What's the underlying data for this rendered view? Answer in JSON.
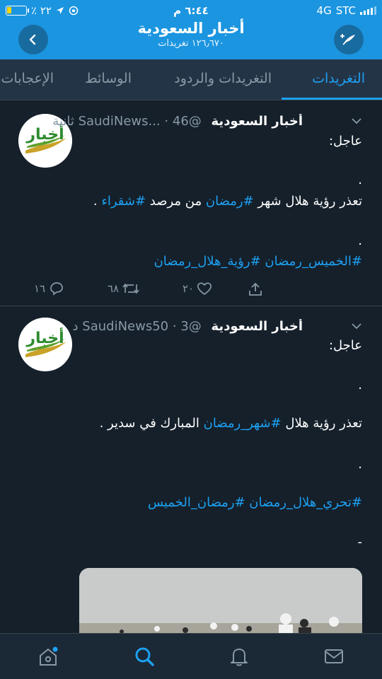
{
  "status_bar": {
    "carrier": "STC",
    "network": "4G",
    "time": "٦:٤٤ م",
    "battery_percent": "٪ ٢٢",
    "battery_level": 0.22
  },
  "header": {
    "title": "أخبار السعودية",
    "tweet_count": "١٢٦٫٦٧٠ تغريدات"
  },
  "tabs": [
    {
      "label": "التغريدات",
      "active": true
    },
    {
      "label": "التغريدات والردود",
      "active": false
    },
    {
      "label": "الوسائط",
      "active": false
    },
    {
      "label": "الإعجابات",
      "active": false
    }
  ],
  "tweets": [
    {
      "name": "أخبار السعودية",
      "handle": "@SaudiNews...",
      "time": "46 ثانية",
      "avatar_text": "أخبار",
      "avatar_sub": "السعودية",
      "line1": "عاجل:",
      "dot1": ".",
      "line2_prefix": "تعذر رؤية هلال شهر ",
      "tag1": "#رمضان",
      "line2_mid": " من مرصد ",
      "tag2": "#شقراء",
      "line2_end": " .",
      "dot2": ".",
      "tags_line": "#الخميس_رمضان #رؤية_هلال_رمضان",
      "replies": "١٦",
      "retweets": "٦٨",
      "likes": "٢٠"
    },
    {
      "name": "أخبار السعودية",
      "handle": "@SaudiNews50",
      "time": "3 د",
      "avatar_text": "أخبار",
      "avatar_sub": "السعودية",
      "line1": "عاجل:",
      "dot1": ".",
      "line2_prefix": "تعذر رؤية هلال ",
      "tag1": "#شهر_رمضان",
      "line2_mid": " المبارك في سدير  .",
      "dot2": ".",
      "tags_line": "#تحري_هلال_رمضان #رمضان_الخميس",
      "dash": "-"
    }
  ],
  "icons": {
    "back": "chevron-left-icon",
    "compose": "compose-tweet-icon",
    "home": "home-icon",
    "search": "search-icon",
    "notifications": "bell-icon",
    "messages": "mail-icon"
  },
  "colors": {
    "accent": "#1da1f2",
    "header": "#1b95e0",
    "background": "#15202b"
  }
}
